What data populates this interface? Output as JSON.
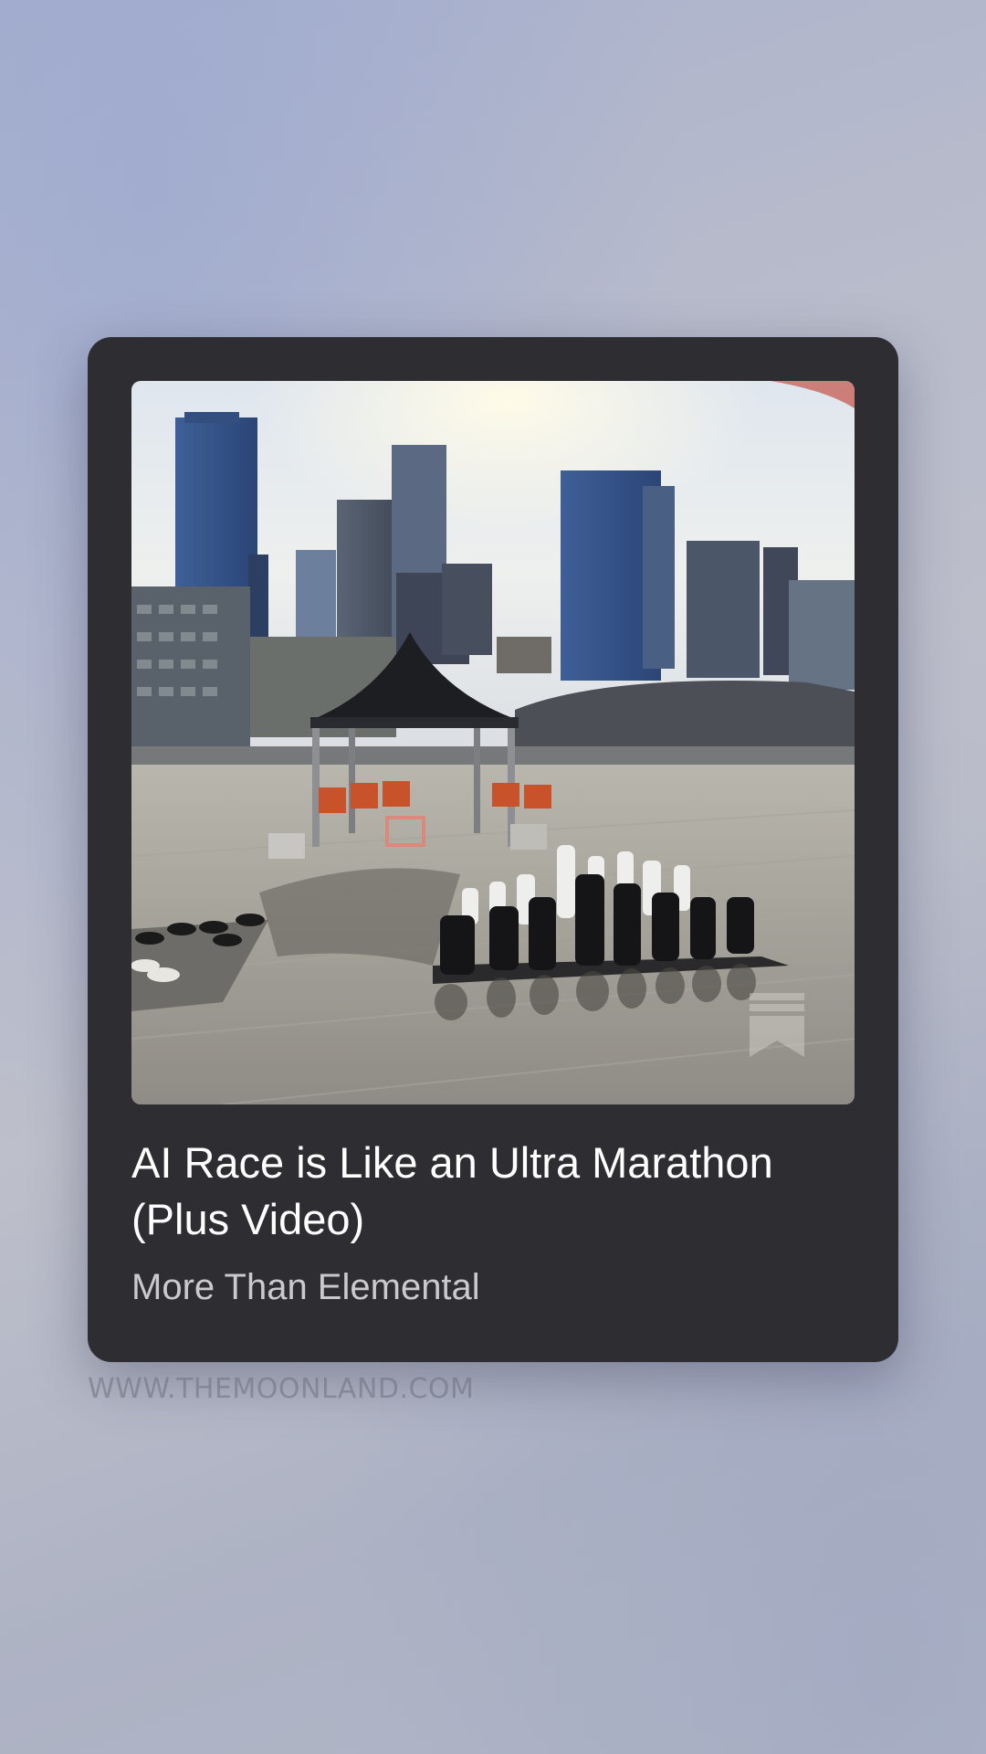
{
  "card": {
    "title": "AI Race is Like an Ultra Marathon (Plus Video)",
    "subtitle": "More Than Elemental",
    "image_icon": "bookmark-icon"
  },
  "watermark": "WWW.THEMOONLAND.COM",
  "colors": {
    "card_background": "#2e2e32",
    "title_text": "#ffffff",
    "subtitle_text": "#c9c9cf"
  }
}
